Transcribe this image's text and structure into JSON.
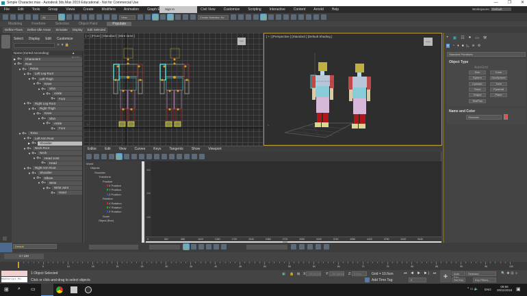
{
  "window": {
    "title": "Simple Character.max - Autodesk 3ds Max 2019 Educational - Not for Commercial Use",
    "controls": [
      "—",
      "❐",
      "✕"
    ]
  },
  "menu": [
    "File",
    "Edit",
    "Tools",
    "Group",
    "Views",
    "Create",
    "Modifiers",
    "Animation",
    "Graph Editors",
    "Rendering",
    "Civil View",
    "Customize",
    "Scripting",
    "Interactive",
    "Content",
    "Arnold",
    "Help"
  ],
  "account": {
    "sign_in": "Sign In",
    "workspaces_label": "Workspaces:",
    "workspace": "Default"
  },
  "toolbar": {
    "filter": "All",
    "ref_coord": "View",
    "selection_set": "Create Selection Se"
  },
  "ribbon": {
    "tabs": [
      "Modeling",
      "Freeform",
      "Selection",
      "Object Paint",
      "Populate"
    ],
    "active": "Populate",
    "buttons": [
      "Define Flows",
      "Define Idle Areas",
      "Simulate",
      "Display",
      "Edit Selected"
    ]
  },
  "scene_explorer": {
    "tabs": [
      "Select",
      "Display",
      "Edit",
      "Customize"
    ],
    "column": "Name (Sorted Ascending)",
    "frozen_col": "▲ Froze",
    "items": [
      {
        "name": "Character2",
        "depth": 0,
        "expanded": false
      },
      {
        "name": "Root",
        "depth": 0,
        "expanded": true
      },
      {
        "name": "Pelvis",
        "depth": 1,
        "expanded": true
      },
      {
        "name": "Left Leg Root",
        "depth": 2,
        "expanded": true
      },
      {
        "name": "Left Thigh",
        "depth": 3,
        "expanded": true
      },
      {
        "name": "Knee",
        "depth": 4,
        "expanded": true
      },
      {
        "name": "Shin",
        "depth": 5,
        "expanded": true
      },
      {
        "name": "Ankle",
        "depth": 6,
        "expanded": true
      },
      {
        "name": "Foot",
        "depth": 7,
        "expanded": null
      },
      {
        "name": "Right Leg Root",
        "depth": 2,
        "expanded": true
      },
      {
        "name": "Right Thigh",
        "depth": 3,
        "expanded": true
      },
      {
        "name": "Knee",
        "depth": 4,
        "expanded": true
      },
      {
        "name": "Shin",
        "depth": 5,
        "expanded": true
      },
      {
        "name": "Ankle",
        "depth": 6,
        "expanded": true
      },
      {
        "name": "Foot",
        "depth": 7,
        "expanded": null
      },
      {
        "name": "Torso",
        "depth": 1,
        "expanded": true
      },
      {
        "name": "Left Arm Root",
        "depth": 2,
        "expanded": true
      },
      {
        "name": "Shoulder",
        "depth": 3,
        "expanded": false,
        "selected": true
      },
      {
        "name": "Neck Root",
        "depth": 2,
        "expanded": true
      },
      {
        "name": "Neck",
        "depth": 3,
        "expanded": true
      },
      {
        "name": "Head Joint",
        "depth": 4,
        "expanded": true
      },
      {
        "name": "Head",
        "depth": 5,
        "expanded": null
      },
      {
        "name": "Right Arm Root",
        "depth": 2,
        "expanded": true
      },
      {
        "name": "Shoulder",
        "depth": 3,
        "expanded": true
      },
      {
        "name": "Elbow",
        "depth": 4,
        "expanded": true
      },
      {
        "name": "Wrist",
        "depth": 5,
        "expanded": true
      },
      {
        "name": "Wrist Joint",
        "depth": 6,
        "expanded": true
      },
      {
        "name": "Hand",
        "depth": 7,
        "expanded": null
      }
    ]
  },
  "viewports": {
    "front": "[ + ] [Front ] [Standard ] [Wireframe ]",
    "perspective": "[ + ] [Perspective ] [Standard ] [Default Shading ]",
    "front_cube": "front",
    "persp_cube": "front"
  },
  "command_panel": {
    "category": "Standard Primitives",
    "rollout_object_type": "Object Type",
    "autogrid": "AutoGrid",
    "buttons": [
      "Box",
      "Cone",
      "Sphere",
      "GeoSphere",
      "Cylinder",
      "Tube",
      "Torus",
      "Pyramid",
      "Teapot",
      "Plane",
      "TextPlus"
    ],
    "rollout_name_color": "Name and Color",
    "object_name": "Shoulder",
    "object_color": "#e05050"
  },
  "track_view": {
    "menu": [
      "Editor",
      "Edit",
      "View",
      "Curves",
      "Keys",
      "Tangents",
      "Show",
      "Viewport"
    ],
    "tree": [
      {
        "label": "World",
        "depth": 0
      },
      {
        "label": "Objects",
        "depth": 1
      },
      {
        "label": "Shoulder",
        "depth": 2
      },
      {
        "label": "Transform",
        "depth": 3
      },
      {
        "label": "Position",
        "depth": 4
      },
      {
        "label": "X Position",
        "depth": 5,
        "color": "#c03030"
      },
      {
        "label": "Y Position",
        "depth": 5,
        "color": "#30a030"
      },
      {
        "label": "Z Position",
        "depth": 5,
        "color": "#3050d0"
      },
      {
        "label": "Rotation",
        "depth": 4
      },
      {
        "label": "X Rotation",
        "depth": 5,
        "color": "#c03030"
      },
      {
        "label": "Y Rotation",
        "depth": 5,
        "color": "#30a030"
      },
      {
        "label": "Z Rotation",
        "depth": 5,
        "color": "#3050d0"
      },
      {
        "label": "Scale",
        "depth": 4
      },
      {
        "label": "Object (Box)",
        "depth": 3
      }
    ],
    "y_ticks": [
      "300",
      "200",
      "100"
    ],
    "frame_field": "0",
    "x_ticks": [
      "0",
      "340",
      "680",
      "1020",
      "1360",
      "1700",
      "2040",
      "2380",
      "2720",
      "3060",
      "3400",
      "3740",
      "4080",
      "4420",
      "4760",
      "5100",
      "5440"
    ]
  },
  "layer": {
    "name": "Default"
  },
  "time_slider": {
    "label": "0 / 100",
    "progress_percent": 0
  },
  "trackbar_ticks": [
    "0",
    "5",
    "10",
    "15",
    "20",
    "25",
    "30",
    "35",
    "40",
    "45",
    "50",
    "55",
    "60",
    "65",
    "70",
    "75",
    "80",
    "85",
    "90",
    "95",
    "100"
  ],
  "status": {
    "selection": "1 Object Selected",
    "prompt": "Click or click-and-drag to select objects",
    "maxscript": "MAXScript Mi:",
    "x": "-39.197cm",
    "y": "-38.156cm",
    "z": "0.0cm",
    "x_label": "X:",
    "y_label": "Y:",
    "z_label": "Z:",
    "grid": "Grid = 10.0cm",
    "add_time_tag": "Add Time Tag",
    "frame": "0",
    "auto_key": "Auto Key",
    "set_key": "Set Key",
    "key_mode": "Selected",
    "key_filters": "Key Filters..."
  },
  "taskbar": {
    "lang": "ENG",
    "time": "09:58",
    "date": "20/11/2018"
  }
}
